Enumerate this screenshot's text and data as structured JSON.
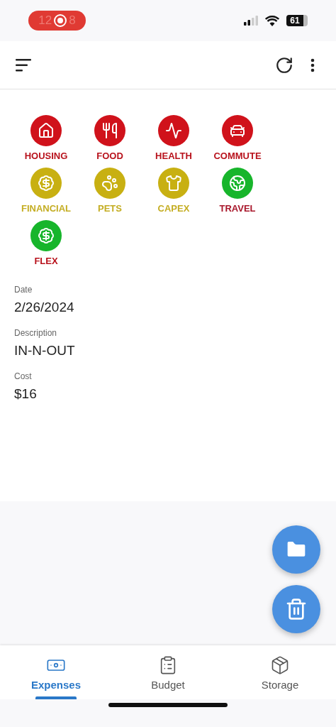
{
  "status_bar": {
    "time_parts": [
      "12",
      "8"
    ],
    "battery": "61"
  },
  "categories": [
    {
      "color": "#d0121b",
      "label": {
        "text": "HOUSING",
        "color": "#b8121c"
      }
    },
    {
      "color": "#d0121b",
      "label": {
        "text": "FOOD",
        "color": "#b8121c"
      }
    },
    {
      "color": "#d0121b",
      "label": {
        "text": "HEALTH",
        "color": "#b8121c"
      }
    },
    {
      "color": "#d0121b",
      "label": {
        "text": "COMMUTE",
        "color": "#b8121c"
      }
    },
    {
      "color": "#c8b012",
      "label": {
        "text": "FINANCIAL",
        "color": "#c4ad22"
      }
    },
    {
      "color": "#c8b012",
      "label": {
        "text": "PETS",
        "color": "#c4ad22"
      }
    },
    {
      "color": "#c8b012",
      "label": {
        "text": "CAPEX",
        "color": "#c4ad22"
      }
    },
    {
      "color": "#17b52b",
      "label": {
        "text": "TRAVEL",
        "color": "#a8162a"
      }
    },
    {
      "color": "#17b52b",
      "label": {
        "text": "FLEX",
        "color": "#b8121c"
      }
    }
  ],
  "fields": [
    {
      "label": "Date",
      "value": "2/26/2024"
    },
    {
      "label": "Description",
      "value": "IN-N-OUT"
    },
    {
      "label": "Cost",
      "value": "$16"
    }
  ],
  "tabs": [
    {
      "label": "Expenses",
      "selected": true
    },
    {
      "label": "Budget",
      "selected": false
    },
    {
      "label": "Storage",
      "selected": false
    }
  ]
}
